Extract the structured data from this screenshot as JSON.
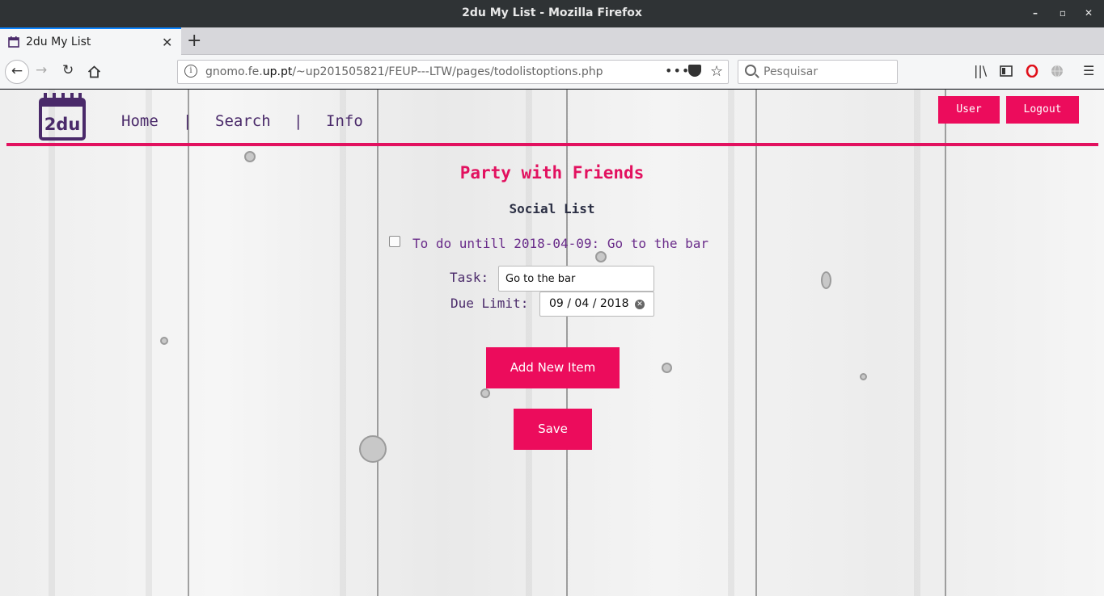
{
  "window": {
    "title": "2du My List - Mozilla Firefox"
  },
  "tab": {
    "label": "2du My List"
  },
  "address": {
    "url_prefix": "gnomo.fe.",
    "url_domain": "up.pt",
    "url_path": "/~up201505821/FEUP---LTW/pages/todolistoptions.php"
  },
  "search": {
    "placeholder": "Pesquisar"
  },
  "site": {
    "logo_text": "2du",
    "nav": {
      "home": "Home",
      "search": "Search",
      "info": "Info",
      "separator": "|"
    },
    "user_button": "User",
    "logout_button": "Logout",
    "accent_color": "#ec0c5c"
  },
  "list": {
    "title": "Party with Friends",
    "category": "Social List",
    "items": [
      {
        "text": "To do untill 2018-04-09: Go to the bar",
        "checked": false
      }
    ]
  },
  "form": {
    "task_label": "Task:",
    "task_value": "Go to the bar",
    "due_label": "Due Limit:",
    "due_value": "09 / 04 / 2018",
    "add_button": "Add New Item",
    "save_button": "Save"
  }
}
